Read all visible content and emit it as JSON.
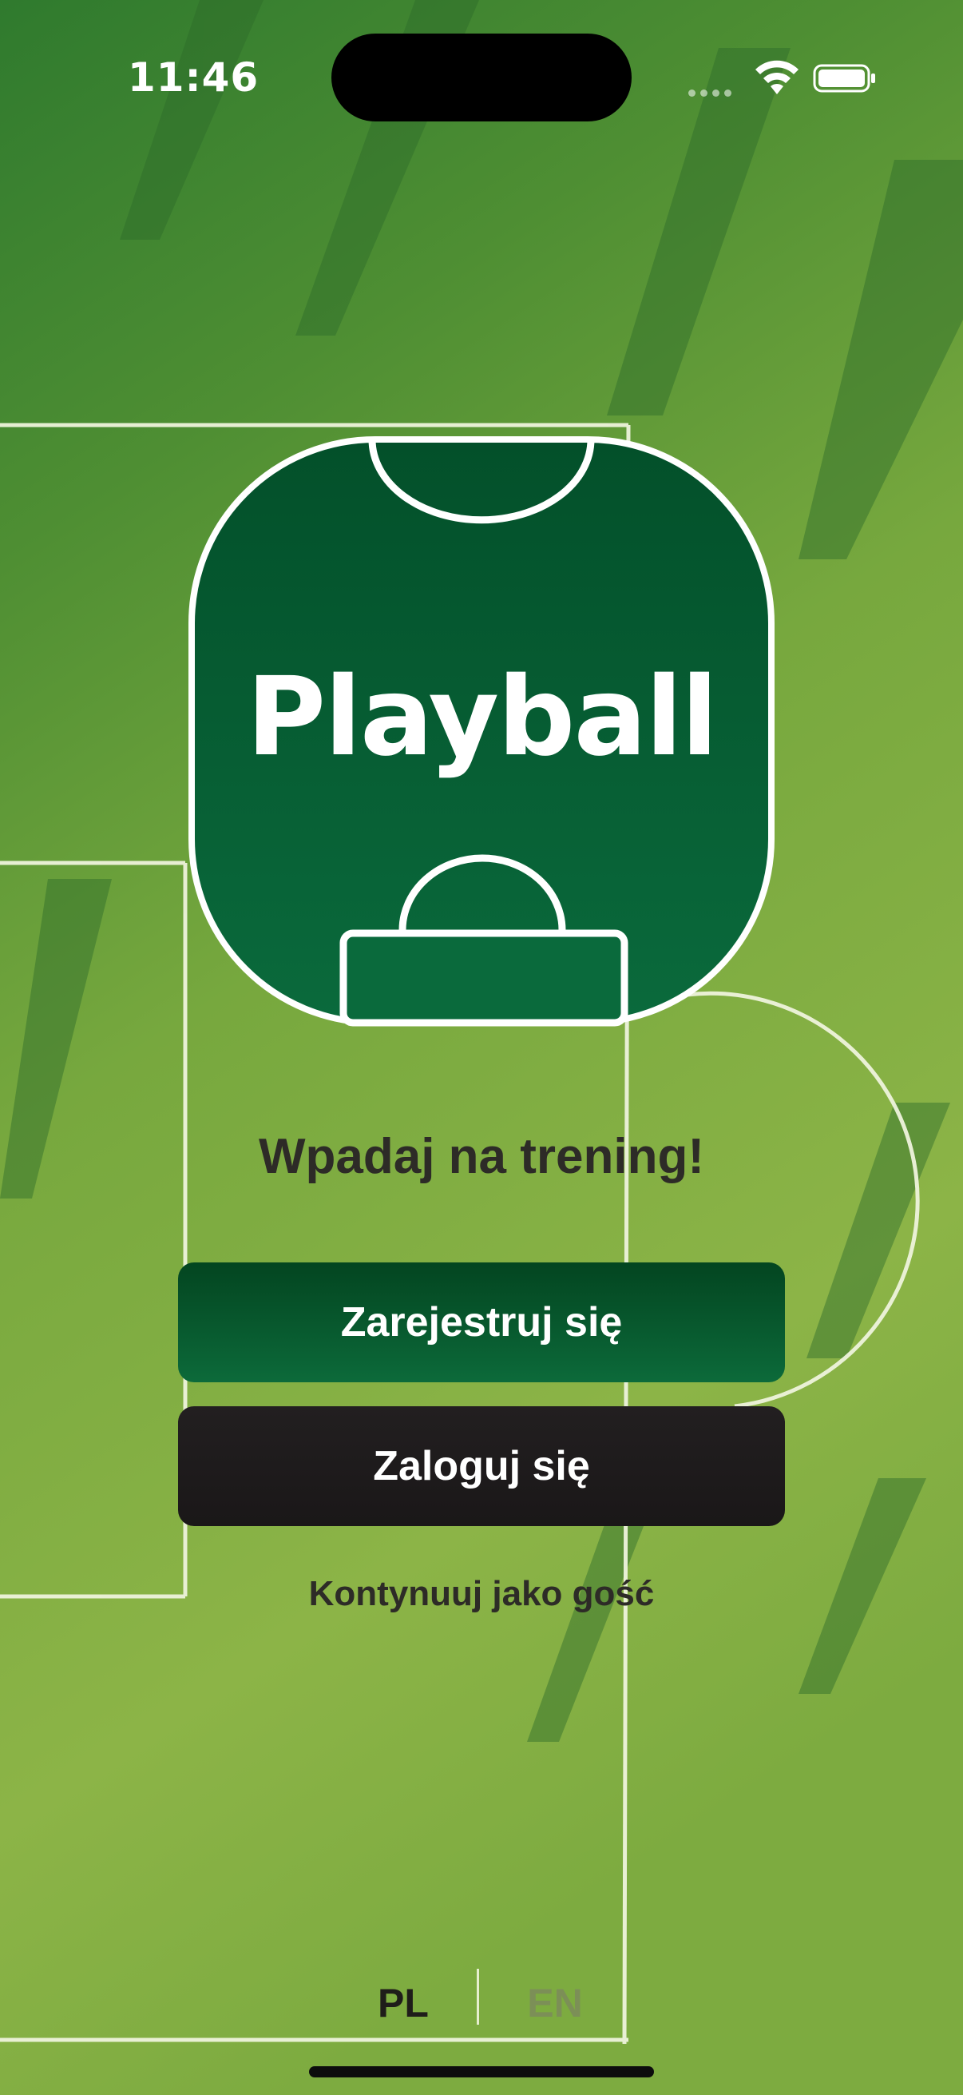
{
  "status_bar": {
    "time": "11:46"
  },
  "logo": {
    "title": "Playball"
  },
  "tagline": "Wpadaj na trening!",
  "buttons": {
    "register": "Zarejestruj się",
    "login": "Zaloguj się"
  },
  "guest_link": "Kontynuuj jako gość",
  "language": {
    "options": [
      "PL",
      "EN"
    ],
    "selected": "PL"
  },
  "colors": {
    "brand_green": "#075a30",
    "dark_button": "#1f1c1d",
    "pitch_green": "#6ea23a"
  }
}
